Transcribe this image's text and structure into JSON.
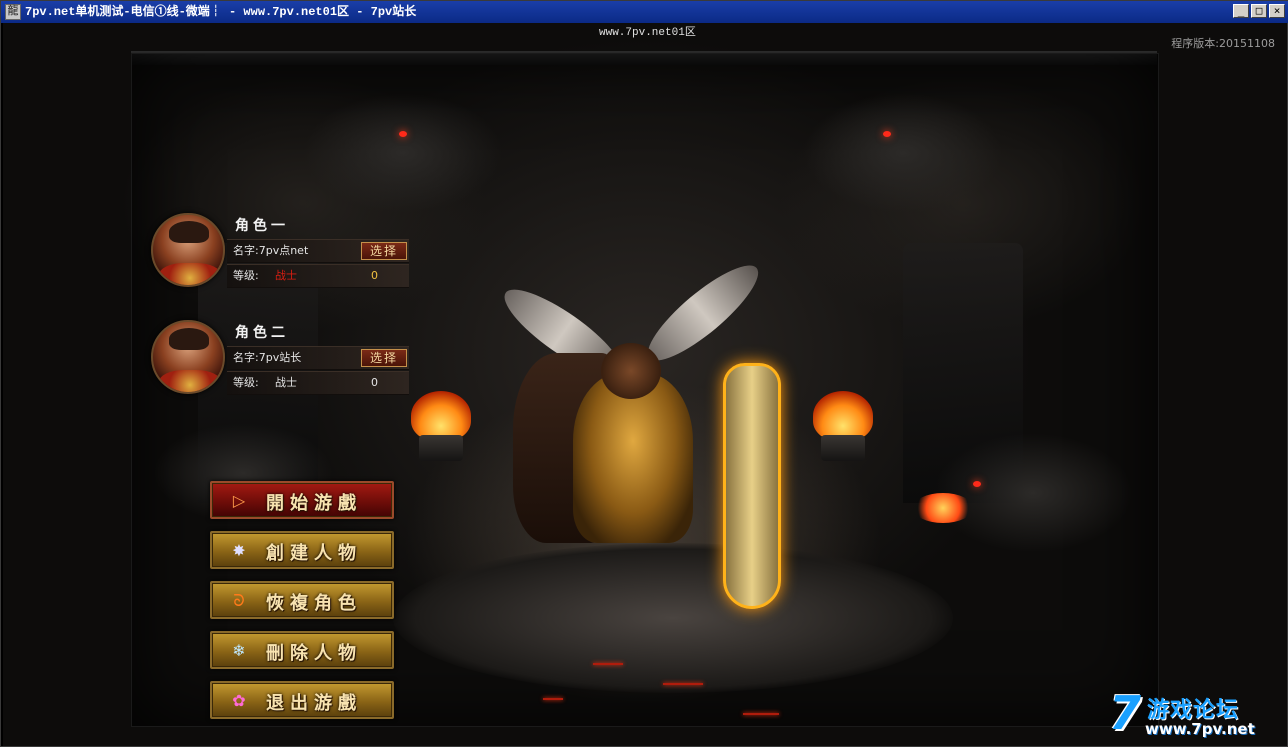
{
  "window": {
    "title": "7pv.net单机测试-电信①线-微端┆ - www.7pv.net01区 - 7pv站长",
    "app_icon": "game-app-icon",
    "buttons": {
      "minimize": "_",
      "maximize": "□",
      "close": "×"
    }
  },
  "header": {
    "server_label": "www.7pv.net01区",
    "version": "程序版本:20151108"
  },
  "characters": [
    {
      "title": "角色一",
      "name_label": "名字:",
      "name": "7pv点net",
      "select_label": "选择",
      "level_label": "等级:",
      "class": "战士",
      "class_color": "#d81e12",
      "level": "0"
    },
    {
      "title": "角色二",
      "name_label": "名字:",
      "name": "7pv站长",
      "select_label": "选择",
      "level_label": "等级:",
      "class": "战士",
      "class_color": "#e4e4e4",
      "level": "0"
    }
  ],
  "menu": [
    {
      "label": "開始游戲",
      "icon": "play-arrow-icon",
      "glyph": "▷",
      "active": true
    },
    {
      "label": "創建人物",
      "icon": "gear-burst-icon",
      "glyph": "✸",
      "active": false
    },
    {
      "label": "恢複角色",
      "icon": "swirl-icon",
      "glyph": "ᘐ",
      "active": false
    },
    {
      "label": "刪除人物",
      "icon": "snowflake-icon",
      "glyph": "❄",
      "active": false
    },
    {
      "label": "退出游戲",
      "icon": "flower-icon",
      "glyph": "✿",
      "active": false
    }
  ],
  "logo": {
    "number": "7",
    "chinese": "游戏论坛",
    "url": "www.7pv.net"
  },
  "colors": {
    "titlebar": "#0b2a86",
    "gold_button": "#c49a30",
    "active_button": "#a41a12",
    "logo_blue": "#1aa0ff"
  }
}
